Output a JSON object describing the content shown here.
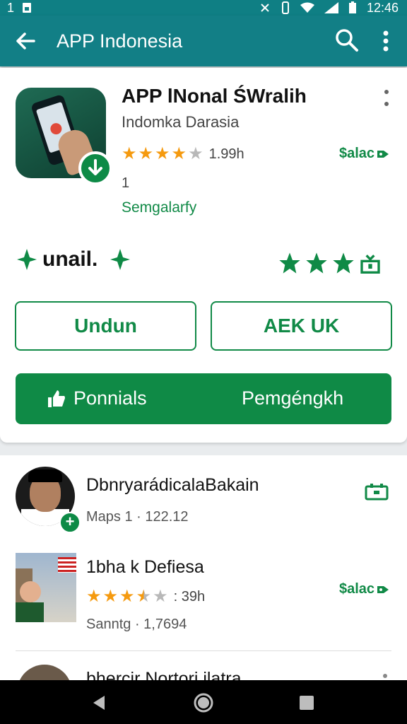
{
  "status_bar": {
    "left_text": "1",
    "time": "12:46"
  },
  "app_bar": {
    "title": "APP Indonesia"
  },
  "app": {
    "name": "APP lNonal ŚWralih",
    "developer": "Indomka Darasia",
    "rating_stars": 4,
    "rating_count": "1.99h",
    "price": "$alac",
    "number": "1",
    "category": "Semgalarfy",
    "unail_text": "unail.",
    "big_star_count": 3
  },
  "buttons": {
    "undun": "Undun",
    "aek": "AEK UK",
    "ponnials": "Ponnials",
    "pengengkh": "Pemgéngkh"
  },
  "list": [
    {
      "title": "DbnryarádicalaBakain",
      "subtitle": "Maps 1 · 122.12"
    },
    {
      "title": "1bha k Defiesa",
      "rating_stars": 3.5,
      "rating_count": ": 39h",
      "price": "$alac",
      "subtitle": "Sanntg · 1,7694"
    },
    {
      "title": "bhercir Nortori ilatra"
    }
  ],
  "colors": {
    "app_bar": "#127f86",
    "accent_green": "#118a47",
    "star": "#f59a0f"
  }
}
